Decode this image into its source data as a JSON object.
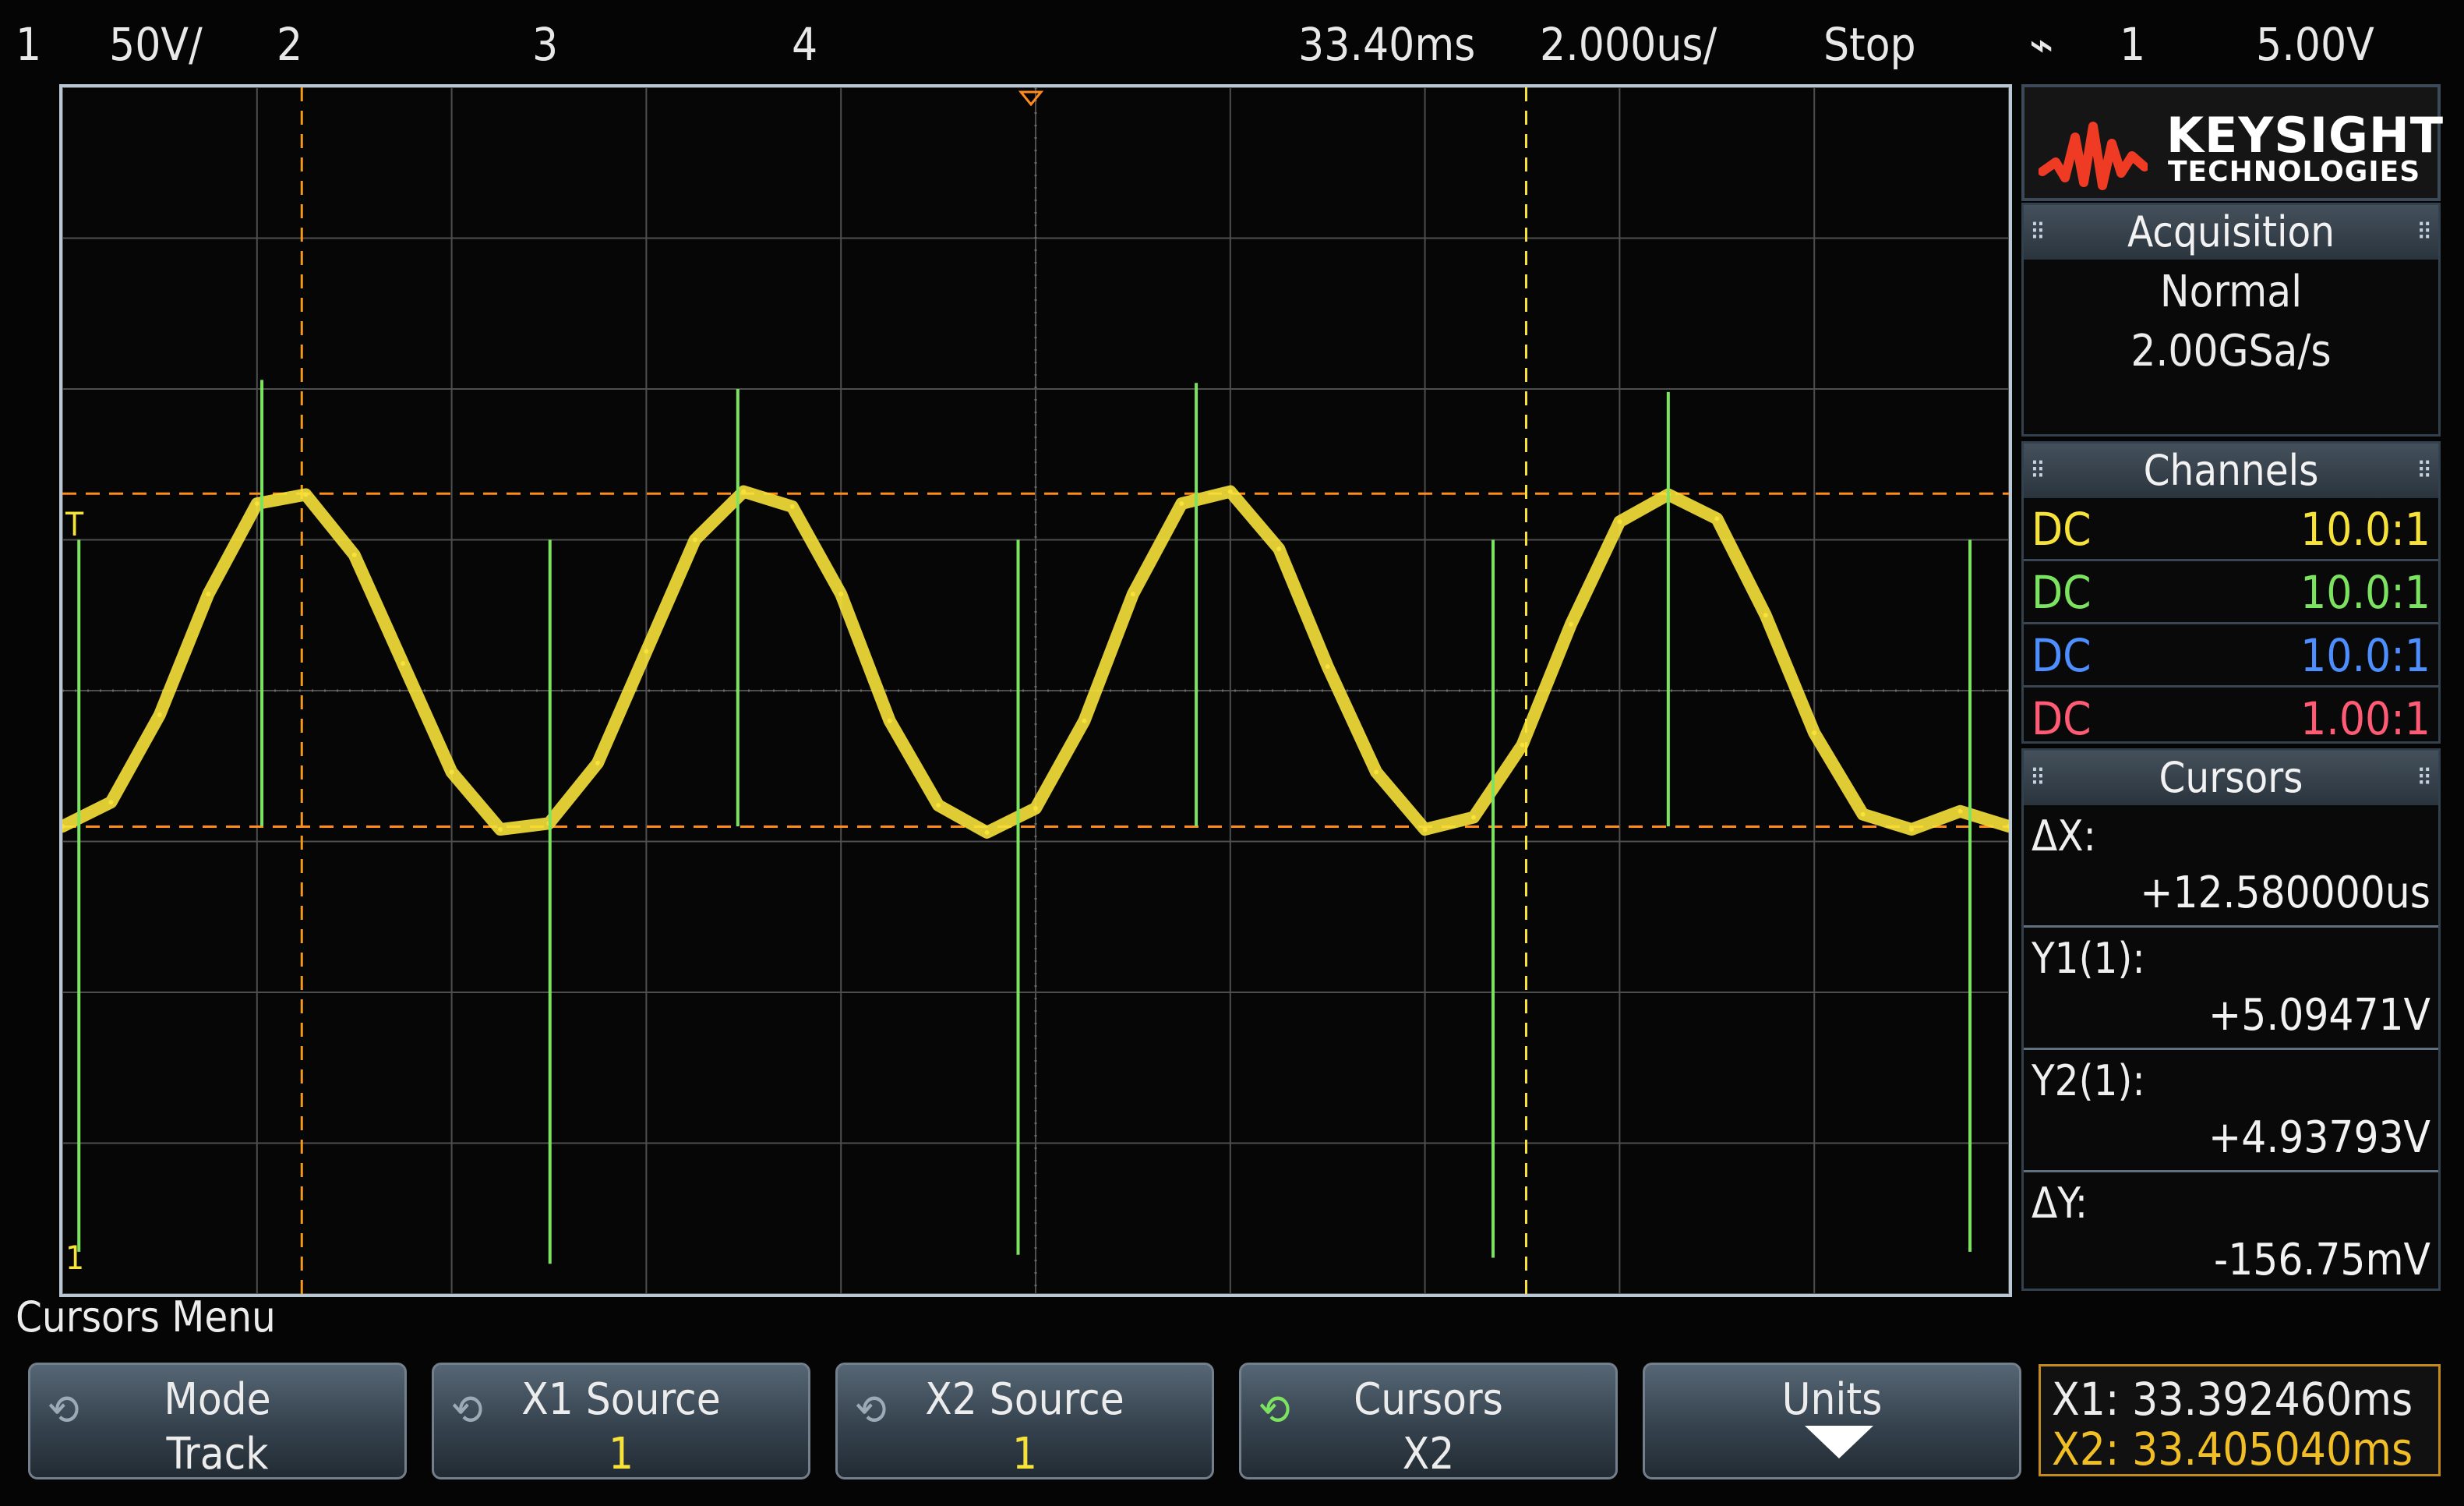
{
  "status_bar": {
    "channels": [
      {
        "number": "1",
        "scale": "50V/",
        "color": "#f7e23a"
      },
      {
        "number": "2",
        "color": "#7be35f"
      },
      {
        "number": "3",
        "color": "#4d8fff"
      },
      {
        "number": "4",
        "color": "#ff5b75"
      }
    ],
    "horizontal_delay": "33.40ms",
    "timebase": "2.000us/",
    "run_state": "Stop",
    "trigger": {
      "icon": "trigger-edge-icon",
      "source": "1",
      "level": "5.00V"
    }
  },
  "display": {
    "trigger_marker": "T",
    "ground_marker": "1"
  },
  "logo": {
    "brand": "KEYSIGHT",
    "subtitle": "TECHNOLOGIES",
    "wave_color": "#ef3b24"
  },
  "acquisition": {
    "title": "Acquisition",
    "mode": "Normal",
    "sample_rate": "2.00GSa/s"
  },
  "channels_panel": {
    "title": "Channels",
    "rows": [
      {
        "coupling": "DC",
        "probe": "10.0:1",
        "color": "#f7e23a"
      },
      {
        "coupling": "DC",
        "probe": "10.0:1",
        "color": "#7be35f"
      },
      {
        "coupling": "DC",
        "probe": "10.0:1",
        "color": "#4d8fff"
      },
      {
        "coupling": "DC",
        "probe": "1.00:1",
        "color": "#ff5b75"
      }
    ]
  },
  "cursors_panel": {
    "title": "Cursors",
    "delta_x_label": "ΔX:",
    "delta_x": "+12.580000us",
    "y1_label": "Y1(1):",
    "y1": "+5.09471V",
    "y2_label": "Y2(1):",
    "y2": "+4.93793V",
    "delta_y_label": "ΔY:",
    "delta_y": "-156.75mV"
  },
  "menu": {
    "title": "Cursors Menu",
    "softkeys": [
      {
        "label": "Mode",
        "value": "Track",
        "value_color": "#ececec"
      },
      {
        "label": "X1 Source",
        "value": "1",
        "value_color": "#f7e23a"
      },
      {
        "label": "X2 Source",
        "value": "1",
        "value_color": "#f7e23a"
      },
      {
        "label": "Cursors",
        "value": "X2",
        "value_color": "#ececec"
      },
      {
        "label": "Units",
        "value": "",
        "value_color": "#ececec"
      }
    ]
  },
  "cursor_readout": {
    "x1": "X1: 33.392460ms",
    "x2": "X2: 33.405040ms",
    "x1_color": "#ececec",
    "x2_color": "#f2be25"
  },
  "colors": {
    "channel_1": "#f7e23a",
    "cursor_y": "#ff8b1a",
    "cursor_x1": "#f49a1a",
    "cursor_x2": "#f7e23a",
    "grid": "#4e4e4e"
  },
  "chart_data": {
    "type": "line",
    "title": "",
    "xlabel": "",
    "ylabel": "",
    "x_unit": "us",
    "y_unit": "V",
    "xlim": [
      0,
      20
    ],
    "ylim": [
      -150,
      250
    ],
    "grid": true,
    "series": [
      {
        "color": "#f7e23a",
        "x": [
          0.0,
          0.5,
          1.0,
          1.5,
          2.0,
          2.5,
          3.0,
          3.5,
          4.0,
          4.5,
          5.0,
          5.5,
          6.0,
          6.5,
          7.0,
          7.5,
          8.0,
          8.5,
          9.0,
          9.5,
          10.0,
          10.5,
          11.0,
          11.5,
          12.0,
          12.5,
          13.0,
          13.5,
          14.0,
          14.5,
          15.0,
          15.5,
          16.0,
          16.5,
          17.0,
          17.5,
          18.0,
          18.5,
          19.0,
          19.5,
          20.0
        ],
        "y": [
          5,
          13,
          42,
          82,
          112,
          115,
          95,
          59,
          23,
          4,
          6,
          26,
          63,
          100,
          116,
          111,
          82,
          40,
          12,
          3,
          11,
          40,
          82,
          112,
          116,
          97,
          58,
          23,
          4,
          8,
          32,
          72,
          106,
          115,
          107,
          75,
          36,
          9,
          4,
          10,
          5
        ]
      },
      {
        "color": "#7be35f",
        "kind": "spikes",
        "x": [
          0.17,
          2.05,
          5.01,
          6.94,
          9.82,
          11.65,
          14.7,
          16.5,
          19.6
        ],
        "y_top": [
          100,
          153,
          100,
          150,
          100,
          152,
          100,
          149,
          100
        ],
        "y_bottom": [
          -136,
          5,
          -140,
          5,
          -137,
          5,
          -138,
          5,
          -136
        ]
      }
    ],
    "cursors": {
      "x1_us": 2.46,
      "x2_us": 15.04,
      "y1_v": 115.3,
      "y2_v": 4.9
    }
  }
}
